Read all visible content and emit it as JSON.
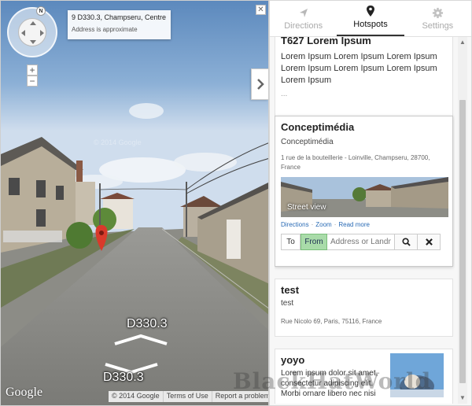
{
  "streetview": {
    "address_title": "9 D330.3, Champseru, Centre",
    "address_subtitle": "Address is approximate",
    "compass_label": "N",
    "zoom_in": "+",
    "zoom_out": "−",
    "close": "✕",
    "road_label_top": "D330.3",
    "road_label_bottom": "D330.3",
    "google_logo": "Google",
    "copyright_watermark": "© 2014 Google",
    "attribution": {
      "copyright": "© 2014 Google",
      "terms": "Terms of Use",
      "report": "Report a problem"
    }
  },
  "tabs": [
    {
      "label": "Directions",
      "icon": "navigation-arrow-icon"
    },
    {
      "label": "Hotspots",
      "icon": "map-pin-icon",
      "active": true
    },
    {
      "label": "Settings",
      "icon": "gear-icon"
    }
  ],
  "hotspots": [
    {
      "title": "Lorem Ipsum",
      "title_visible": "T627 Lorem Ipsum",
      "body": "Lorem Ipsum Lorem Ipsum Lorem Ipsum Lorem Ipsum Lorem Ipsum Lorem Ipsum Lorem Ipsum",
      "ellipsis": "..."
    },
    {
      "title": "Conceptimédia",
      "subtitle": "Conceptimédia",
      "address": "1 rue de la bouteillerie - Loinville, Champseru, 28700, France",
      "thumbnail_label": "Street view",
      "links": {
        "directions": "Directions",
        "zoom": "Zoom",
        "read_more": "Read more"
      },
      "route": {
        "to": "To",
        "from": "From",
        "placeholder": "Address or Landmark"
      }
    },
    {
      "title": "test",
      "subtitle": "test",
      "address": "Rue Nicolo 69, Paris, 75116, France"
    },
    {
      "title": "yoyo",
      "body": "Lorem ipsum dolor sit amet, consectetur adipiscing elit. Morbi ornare libero nec nisi"
    }
  ],
  "watermark": "BlackHatWorld",
  "colors": {
    "active_tab": "#111111",
    "from_button": "#a9dba9",
    "link": "#2a6bb5",
    "pin": "#d93a2b"
  }
}
